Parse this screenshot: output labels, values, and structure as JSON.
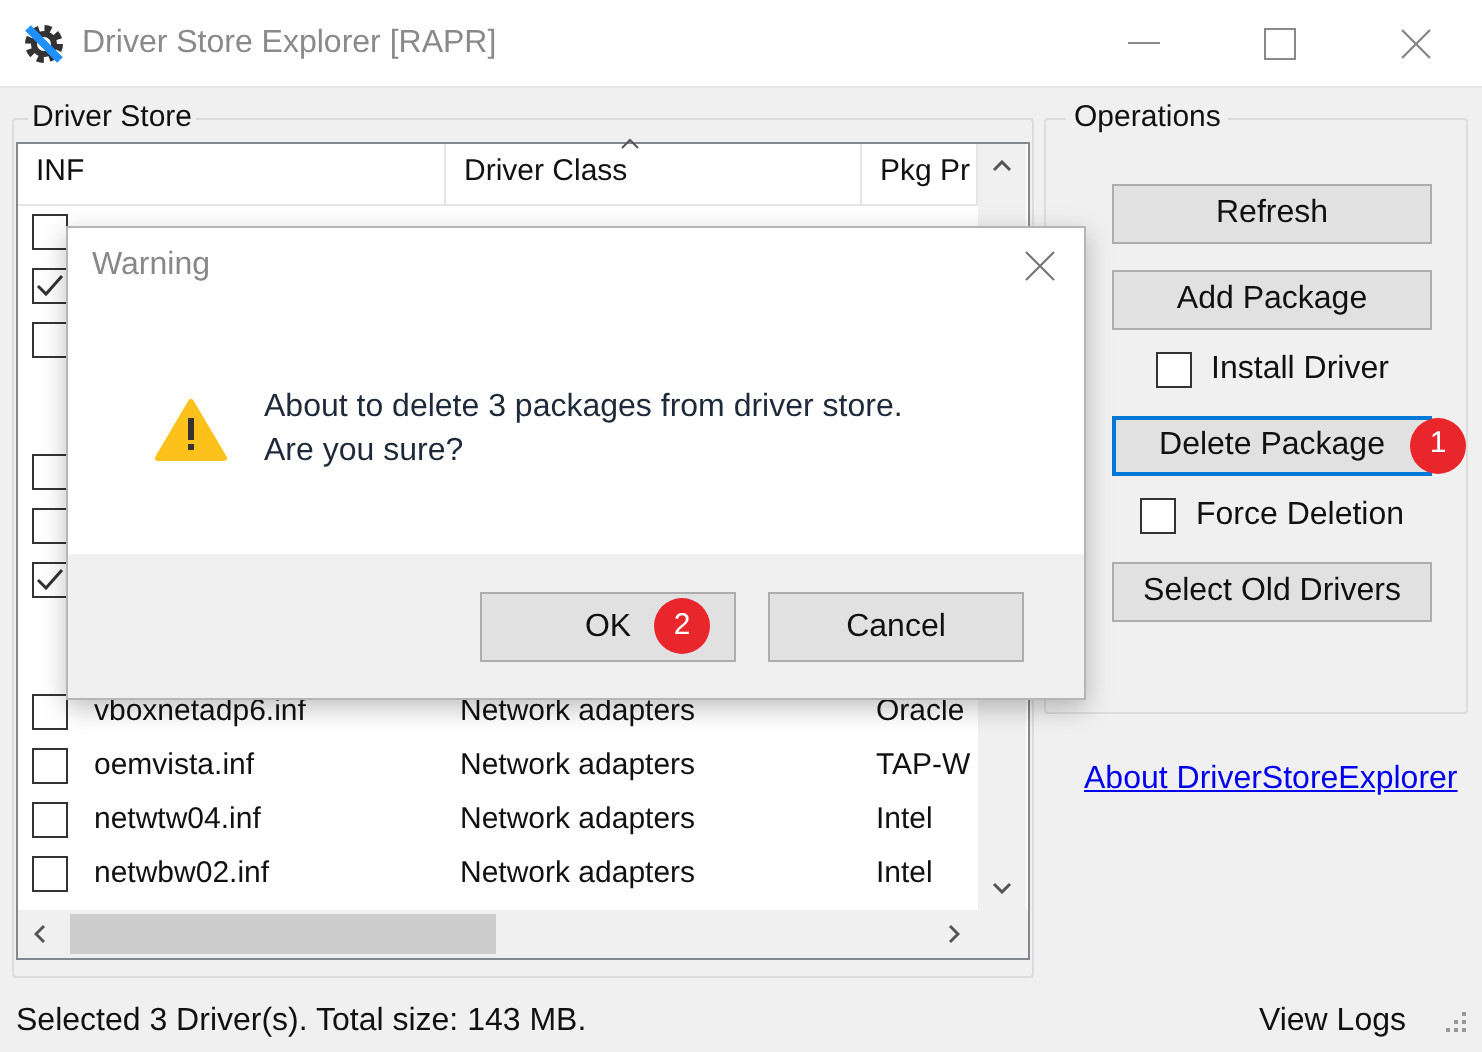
{
  "window": {
    "title": "Driver Store Explorer [RAPR]"
  },
  "driver_store": {
    "label": "Driver Store",
    "columns": [
      {
        "label": "INF",
        "sorted": false
      },
      {
        "label": "Driver Class",
        "sorted": true
      },
      {
        "label": "Pkg Pr",
        "sorted": false
      }
    ],
    "rows": [
      {
        "kind": "driver",
        "checked": false
      },
      {
        "kind": "driver",
        "checked": true
      },
      {
        "kind": "driver",
        "checked": false
      },
      {
        "kind": "group"
      },
      {
        "kind": "driver",
        "checked": false
      },
      {
        "kind": "driver",
        "checked": false
      },
      {
        "kind": "driver",
        "checked": true
      },
      {
        "kind": "group"
      },
      {
        "kind": "driver",
        "checked": false,
        "inf": "vboxnetadp6.inf",
        "driver_class": "Network adapters",
        "column_3": "Oracle"
      },
      {
        "kind": "driver",
        "checked": false,
        "inf": "oemvista.inf",
        "driver_class": "Network adapters",
        "column_3": "TAP-W"
      },
      {
        "kind": "driver",
        "checked": false,
        "inf": "netwtw04.inf",
        "driver_class": "Network adapters",
        "column_3": "Intel"
      },
      {
        "kind": "driver",
        "checked": false,
        "inf": "netwbw02.inf",
        "driver_class": "Network adapters",
        "column_3": "Intel"
      }
    ]
  },
  "operations": {
    "label": "Operations",
    "items": [
      {
        "kind": "button",
        "label": "Refresh",
        "focused": false
      },
      {
        "kind": "button",
        "label": "Add Package",
        "focused": false
      },
      {
        "kind": "checkbox",
        "label": "Install Driver",
        "checked": false
      },
      {
        "kind": "button",
        "label": "Delete Package",
        "focused": true,
        "badge": "1"
      },
      {
        "kind": "checkbox",
        "label": "Force Deletion",
        "checked": false
      },
      {
        "kind": "button",
        "label": "Select Old Drivers",
        "focused": false
      }
    ]
  },
  "about_link": "About DriverStoreExplorer",
  "status_bar": {
    "text": "Selected 3 Driver(s). Total size: 143 MB.",
    "view_logs": "View Logs"
  },
  "dialog": {
    "title": "Warning",
    "message": "About to delete 3 packages from driver store.\nAre you sure?",
    "buttons": [
      {
        "label": "OK",
        "badge": "2"
      },
      {
        "label": "Cancel"
      }
    ]
  }
}
